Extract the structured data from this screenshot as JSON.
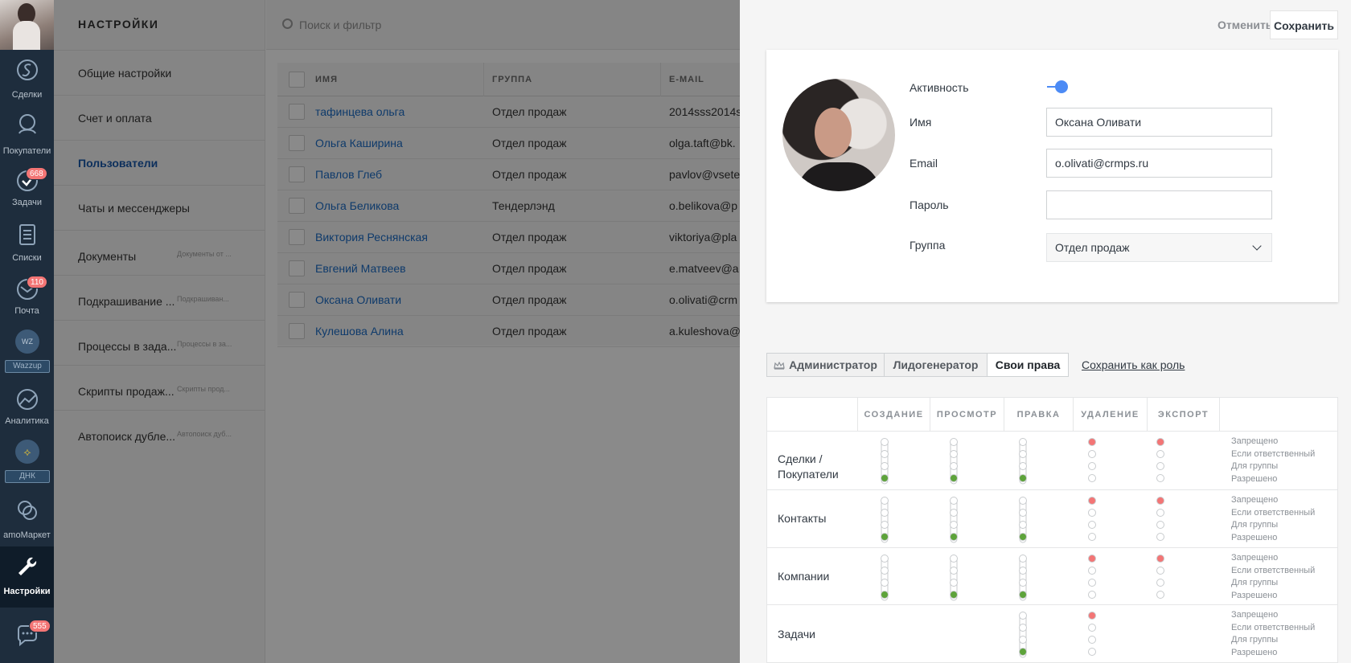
{
  "colors": {
    "accent": "#4c8bf5",
    "nav_bg": "#1e2d3d",
    "badge": "#f37575",
    "level_green": "#5da33a",
    "level_red": "#f37575"
  },
  "nav": {
    "items": [
      {
        "label": "Сделки",
        "icon": "deals-icon"
      },
      {
        "label": "Покупатели",
        "icon": "customers-icon"
      },
      {
        "label": "Задачи",
        "icon": "tasks-icon",
        "badge": "668"
      },
      {
        "label": "Списки",
        "icon": "lists-icon"
      },
      {
        "label": "Почта",
        "icon": "mail-icon",
        "badge": "110"
      },
      {
        "label": "Wazzup",
        "icon": "wazzup-icon",
        "logo_text": "WZ"
      },
      {
        "label": "Аналитика",
        "icon": "analytics-icon"
      },
      {
        "label": "ДНК",
        "icon": "dnk-icon"
      },
      {
        "label": "amoМаркет",
        "icon": "amomarket-icon"
      },
      {
        "label": "Настройки",
        "icon": "settings-icon"
      }
    ],
    "chat_badge": "555"
  },
  "settings": {
    "title": "НАСТРОЙКИ",
    "items": [
      {
        "label": "Общие настройки",
        "desc": ""
      },
      {
        "label": "Счет и оплата",
        "desc": ""
      },
      {
        "label": "Пользователи",
        "desc": ""
      },
      {
        "label": "Чаты и мессенджеры",
        "desc": ""
      },
      {
        "label": "Документы",
        "desc": "Документы от ..."
      },
      {
        "label": "Подкрашивание ...",
        "desc": "Подкрашиван..."
      },
      {
        "label": "Процессы в зада...",
        "desc": "Процессы в за..."
      },
      {
        "label": "Скрипты продаж...",
        "desc": "Скрипты прод..."
      },
      {
        "label": "Автопоиск дубле...",
        "desc": "Автопоиск дуб..."
      }
    ]
  },
  "search": {
    "placeholder": "Поиск и фильтр"
  },
  "users_table": {
    "headers": {
      "name": "ИМЯ",
      "group": "ГРУППА",
      "email": "E-MAIL"
    },
    "rows": [
      {
        "name": "тафинцева ольга",
        "group": "Отдел продаж",
        "email": "2014sss2014s"
      },
      {
        "name": "Ольга Каширина",
        "group": "Отдел продаж",
        "email": "olga.taft@bk."
      },
      {
        "name": "Павлов Глеб",
        "group": "Отдел продаж",
        "email": "pavlov@vsete"
      },
      {
        "name": "Ольга Беликова",
        "group": "Тендерлэнд",
        "email": "o.belikova@p"
      },
      {
        "name": "Виктория Реснянская",
        "group": "Отдел продаж",
        "email": "viktoriya@pla"
      },
      {
        "name": "Евгений Матвеев",
        "group": "Отдел продаж",
        "email": "e.matveev@a"
      },
      {
        "name": "Оксана Оливати",
        "group": "Отдел продаж",
        "email": "o.olivati@crm"
      },
      {
        "name": "Кулешова Алина",
        "group": "Отдел продаж",
        "email": "a.kuleshova@"
      }
    ]
  },
  "modal": {
    "cancel": "Отменить",
    "save": "Сохранить",
    "profile": {
      "activity_label": "Активность",
      "activity_on": true,
      "name_label": "Имя",
      "name_value": "Оксана Оливати",
      "email_label": "Email",
      "email_value": "o.olivati@crmps.ru",
      "password_label": "Пароль",
      "password_value": "",
      "group_label": "Группа",
      "group_value": "Отдел продаж"
    },
    "roles": {
      "tabs": [
        "Администратор",
        "Лидогенератор",
        "Свои права"
      ],
      "active_tab": "Свои права",
      "save_as_role": "Сохранить как роль"
    },
    "rights": {
      "columns": [
        "СОЗДАНИЕ",
        "ПРОСМОТР",
        "ПРАВКА",
        "УДАЛЕНИЕ",
        "ЭКСПОРТ"
      ],
      "levels": [
        "Запрещено",
        "Если ответственный",
        "Для группы",
        "Разрешено"
      ],
      "rows": [
        {
          "name": "Сделки / Покупатели",
          "values": [
            "Разрешено",
            "Разрешено",
            "Разрешено",
            "Запрещено",
            "Запрещено"
          ]
        },
        {
          "name": "Контакты",
          "values": [
            "Разрешено",
            "Разрешено",
            "Разрешено",
            "Запрещено",
            "Запрещено"
          ]
        },
        {
          "name": "Компании",
          "values": [
            "Разрешено",
            "Разрешено",
            "Разрешено",
            "Запрещено",
            "Запрещено"
          ]
        },
        {
          "name": "Задачи",
          "values": [
            null,
            null,
            "Разрешено",
            "Запрещено",
            null
          ]
        }
      ]
    }
  }
}
